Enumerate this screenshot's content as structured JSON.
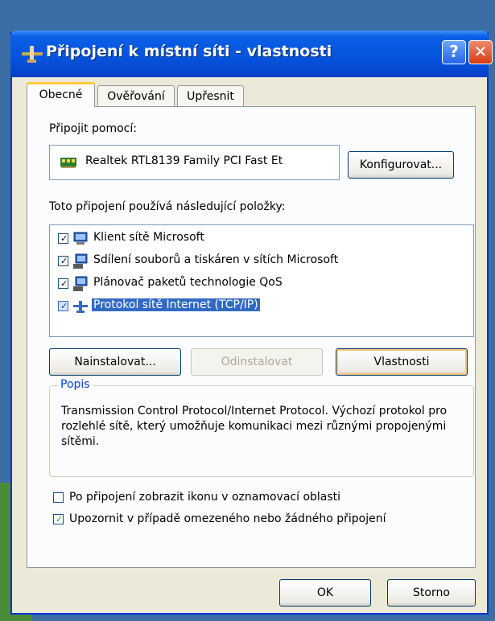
{
  "window": {
    "title": "Připojení k místní síti - vlastnosti",
    "help_label": "?",
    "close_label": "✕"
  },
  "tabs": [
    {
      "label": "Obecné",
      "active": true
    },
    {
      "label": "Ověřování",
      "active": false
    },
    {
      "label": "Upřesnit",
      "active": false
    }
  ],
  "connect_using": {
    "label": "Připojit pomocí:",
    "adapter": "Realtek RTL8139 Family PCI Fast Et",
    "configure_label": "Konfigurovat..."
  },
  "components": {
    "label": "Toto připojení používá následující položky:",
    "items": [
      {
        "label": "Klient sítě Microsoft",
        "checked": true,
        "icon": "network-client-icon",
        "selected": false
      },
      {
        "label": "Sdílení souborů a tiskáren v sítích Microsoft",
        "checked": true,
        "icon": "network-service-icon",
        "selected": false
      },
      {
        "label": "Plánovač paketů technologie QoS",
        "checked": true,
        "icon": "network-service-icon",
        "selected": false
      },
      {
        "label": "Protokol sítě Internet (TCP/IP)",
        "checked": true,
        "icon": "network-protocol-icon",
        "selected": true
      }
    ]
  },
  "actions": {
    "install": "Nainstalovat...",
    "uninstall": "Odinstalovat",
    "properties": "Vlastnosti"
  },
  "description": {
    "title": "Popis",
    "text": "Transmission Control Protocol/Internet Protocol. Výchozí protokol pro rozlehlé sítě, který umožňuje komunikaci mezi různými propojenými sítěmi."
  },
  "options": [
    {
      "label": "Po připojení zobrazit ikonu v oznamovací oblasti",
      "checked": false
    },
    {
      "label": "Upozornit v případě omezeného nebo žádného připojení",
      "checked": true
    }
  ],
  "footer": {
    "ok": "OK",
    "cancel": "Storno"
  },
  "colors": {
    "titlebar": "#0553dc",
    "selection": "#316ac5",
    "group_title": "#0046d5"
  }
}
